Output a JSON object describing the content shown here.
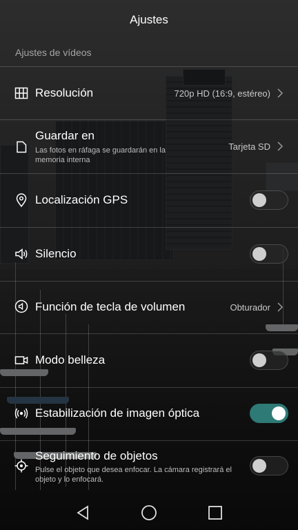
{
  "header": {
    "title": "Ajustes"
  },
  "section": {
    "title": "Ajustes de vídeos"
  },
  "rows": {
    "resolucion": {
      "label": "Resolución",
      "value": "720p HD (16:9, estéreo)",
      "icon": "grid-icon"
    },
    "guardar": {
      "label": "Guardar en",
      "sublabel": "Las fotos en ráfaga se guardarán en la memoria interna",
      "value": "Tarjeta SD",
      "icon": "file-icon"
    },
    "gps": {
      "label": "Localización GPS",
      "toggle": "off",
      "icon": "location-pin-icon"
    },
    "silencio": {
      "label": "Silencio",
      "toggle": "off",
      "icon": "speaker-icon"
    },
    "volumen": {
      "label": "Función de tecla de volumen",
      "value": "Obturador",
      "icon": "volume-key-icon"
    },
    "belleza": {
      "label": "Modo belleza",
      "toggle": "off",
      "icon": "video-camera-icon"
    },
    "estabilizacion": {
      "label": "Estabilización de imagen óptica",
      "toggle": "on",
      "icon": "stabilization-icon"
    },
    "seguimiento": {
      "label": "Seguimiento de objetos",
      "sublabel": "Pulse el objeto que desea enfocar. La cámara registrará el objeto y lo enfocará.",
      "toggle": "off",
      "icon": "target-icon"
    }
  },
  "colors": {
    "accent": "#2d7a76",
    "text": "#ffffff",
    "subtext": "#bdbdbd"
  },
  "navbar": {
    "back_icon": "back-triangle-icon",
    "home_icon": "home-circle-icon",
    "recents_icon": "recents-square-icon"
  }
}
